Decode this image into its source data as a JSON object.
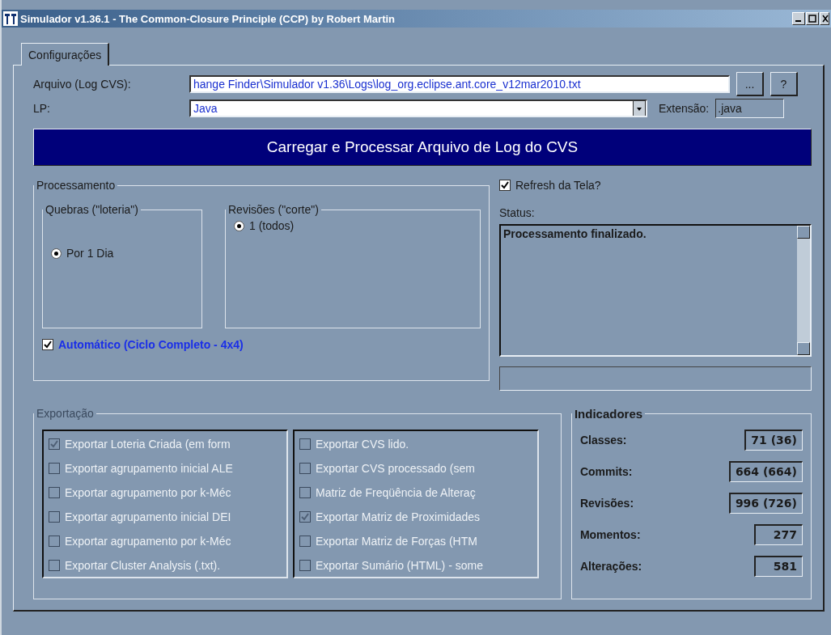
{
  "window": {
    "title": "Simulador v1.36.1 - The Common-Closure Principle (CCP) by Robert Martin"
  },
  "tabs": [
    {
      "label": "Configurações",
      "selected": true
    }
  ],
  "file": {
    "label": "Arquivo (Log CVS):",
    "value": "hange Finder\\Simulador v1.36\\Logs\\log_org.eclipse.ant.core_v12mar2010.txt",
    "browse_button": "...",
    "help_button": "?"
  },
  "language": {
    "label": "LP:",
    "value": "Java"
  },
  "extension": {
    "label": "Extensão:",
    "value": ".java"
  },
  "load_button": "Carregar e Processar Arquivo de Log do CVS",
  "processing": {
    "title": "Processamento",
    "breaks": {
      "title": "Quebras (\"loteria\")",
      "options": [
        {
          "label": "Por 1 Dia",
          "selected": true
        }
      ]
    },
    "revisions": {
      "title": "Revisões (\"corte\")",
      "options": [
        {
          "label": "1 (todos)",
          "selected": true
        }
      ]
    },
    "auto": {
      "label": "Automático (Ciclo Completo - 4x4)",
      "checked": true
    }
  },
  "refresh": {
    "label": "Refresh da Tela?",
    "checked": true
  },
  "status": {
    "label": "Status:",
    "text": "Processamento finalizado."
  },
  "export": {
    "title": "Exportação",
    "disabled": true,
    "columns": [
      [
        {
          "label": "Exportar Loteria Criada (em form",
          "checked": true
        },
        {
          "label": "Exportar agrupamento inicial ALE",
          "checked": false
        },
        {
          "label": "Exportar agrupamento por k-Méc",
          "checked": false
        },
        {
          "label": "Exportar agrupamento inicial DEI",
          "checked": false
        },
        {
          "label": "Exportar agrupamento por k-Méc",
          "checked": false
        },
        {
          "label": "Exportar Cluster Analysis (.txt).",
          "checked": false
        }
      ],
      [
        {
          "label": "Exportar CVS lido.",
          "checked": false
        },
        {
          "label": "Exportar CVS processado (sem",
          "checked": false
        },
        {
          "label": "Matriz de Freqüência de Alteraç",
          "checked": false
        },
        {
          "label": "Exportar Matriz de Proximidades",
          "checked": true
        },
        {
          "label": "Exportar Matriz de Forças (HTM",
          "checked": false
        },
        {
          "label": "Exportar Sumário (HTML) - some",
          "checked": false
        }
      ]
    ]
  },
  "indicators": {
    "title": "Indicadores",
    "items": [
      {
        "label": "Classes:",
        "value": "71 (36)"
      },
      {
        "label": "Commits:",
        "value": "664 (664)"
      },
      {
        "label": "Revisões:",
        "value": "996 (726)"
      },
      {
        "label": "Momentos:",
        "value": "277"
      },
      {
        "label": "Alterações:",
        "value": "581"
      }
    ]
  }
}
